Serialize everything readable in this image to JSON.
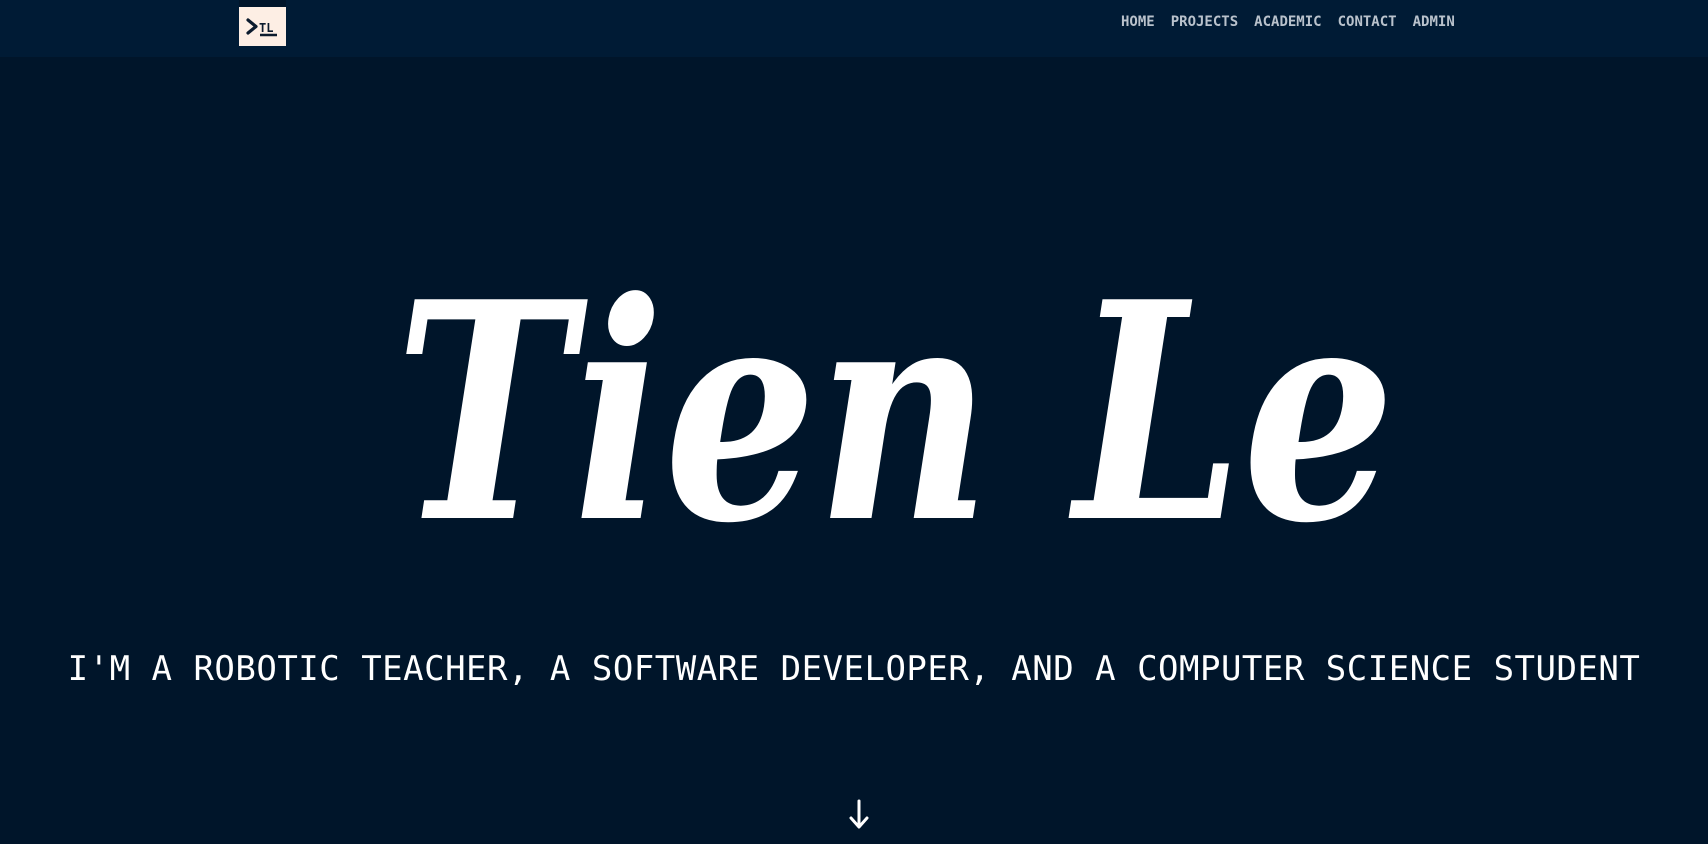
{
  "header": {
    "logo_icon": "terminal-prompt-icon",
    "logo_text": "TL",
    "nav": [
      {
        "label": "HOME"
      },
      {
        "label": "PROJECTS"
      },
      {
        "label": "ACADEMIC"
      },
      {
        "label": "CONTACT"
      },
      {
        "label": "ADMIN"
      }
    ]
  },
  "hero": {
    "name": "Tien Le",
    "tagline": "I'M A ROBOTIC TEACHER, A SOFTWARE DEVELOPER, AND A COMPUTER SCIENCE STUDENT",
    "scroll_icon": "arrow-down-icon"
  },
  "colors": {
    "background": "#00152a",
    "navbar": "#001b35",
    "nav_text": "#b9c2cc",
    "logo_bg": "#fdeee4",
    "text": "#ffffff"
  }
}
